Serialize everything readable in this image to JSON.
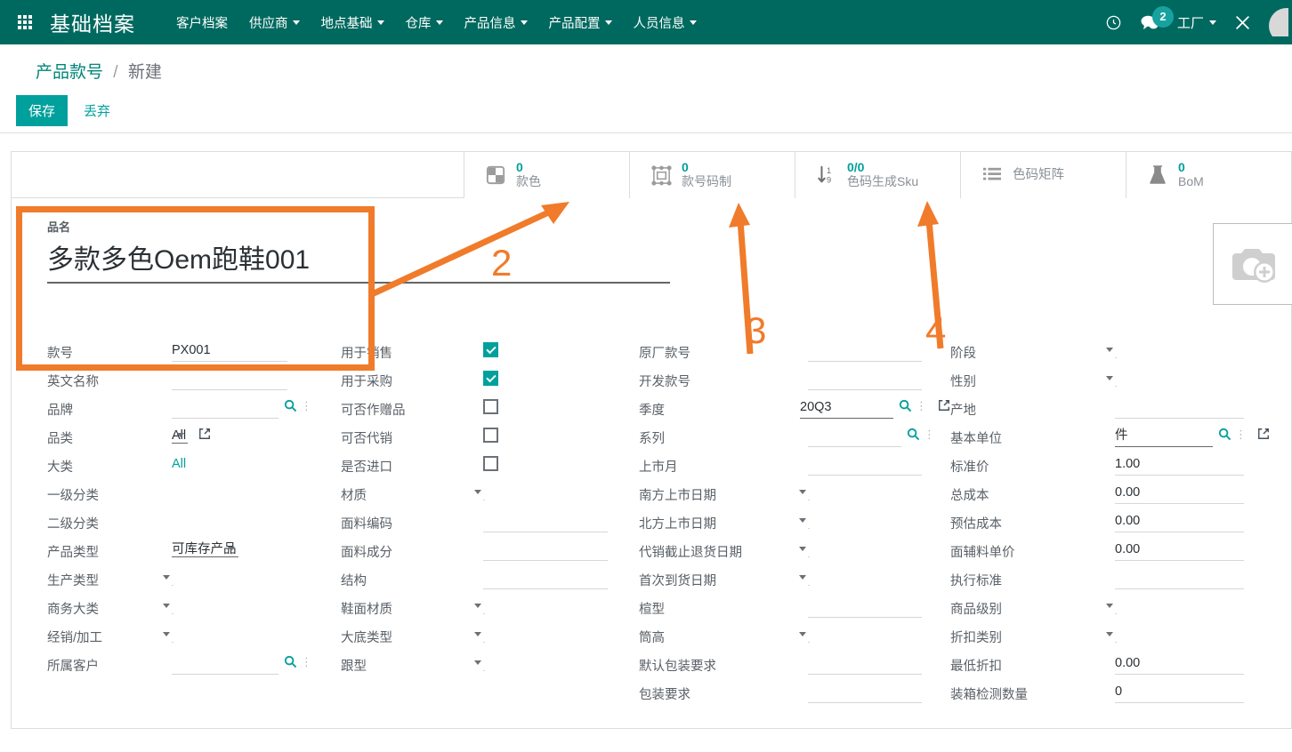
{
  "navbar": {
    "apps_icon": "grid-apps-icon",
    "brand": "基础档案",
    "menu": [
      {
        "label": "客户档案",
        "caret": false
      },
      {
        "label": "供应商",
        "caret": true
      },
      {
        "label": "地点基础",
        "caret": true
      },
      {
        "label": "仓库",
        "caret": true
      },
      {
        "label": "产品信息",
        "caret": true
      },
      {
        "label": "产品配置",
        "caret": true
      },
      {
        "label": "人员信息",
        "caret": true
      }
    ],
    "right": {
      "clock_icon": "clock-icon",
      "chat_icon": "chat-bubble-icon",
      "chat_badge": "2",
      "company": "工厂",
      "tools_icon": "wrench-icon",
      "avatar": "user-avatar"
    }
  },
  "breadcrumb": {
    "root": "产品款号",
    "separator": "/",
    "current": "新建"
  },
  "actions": {
    "save": "保存",
    "discard": "丢弃"
  },
  "stat_buttons": [
    {
      "value": "0",
      "label": "款色",
      "icon": "checkerboard-icon"
    },
    {
      "value": "0",
      "label": "款号码制",
      "icon": "frame-select-icon"
    },
    {
      "value": "0/0",
      "label": "色码生成Sku",
      "icon": "sort-numeric-icon"
    },
    {
      "value": "",
      "label": "色码矩阵",
      "icon": "list-icon"
    },
    {
      "value": "0",
      "label": "BoM",
      "icon": "flask-icon"
    }
  ],
  "title": {
    "label": "品名",
    "value": "多款多色Oem跑鞋001"
  },
  "photo": {
    "icon": "camera-add-icon"
  },
  "columns": {
    "col1": [
      {
        "label": "款号",
        "value": "PX001",
        "type": "text"
      },
      {
        "label": "英文名称",
        "value": "",
        "type": "text"
      },
      {
        "label": "品牌",
        "value": "",
        "type": "search"
      },
      {
        "label": "品类",
        "value": "All",
        "type": "select-ext"
      },
      {
        "label": "大类",
        "value": "All",
        "type": "readonly-teal"
      },
      {
        "label": "一级分类",
        "value": "",
        "type": "blank"
      },
      {
        "label": "二级分类",
        "value": "",
        "type": "blank"
      },
      {
        "label": "产品类型",
        "value": "可库存产品",
        "type": "select"
      },
      {
        "label": "生产类型",
        "value": "",
        "type": "select"
      },
      {
        "label": "商务大类",
        "value": "",
        "type": "select"
      },
      {
        "label": "经销/加工",
        "value": "",
        "type": "select"
      },
      {
        "label": "所属客户",
        "value": "",
        "type": "search"
      }
    ],
    "col2": [
      {
        "label": "用于销售",
        "value": "",
        "type": "checkbox",
        "checked": true
      },
      {
        "label": "用于采购",
        "value": "",
        "type": "checkbox",
        "checked": true
      },
      {
        "label": "可否作赠品",
        "value": "",
        "type": "checkbox",
        "checked": false
      },
      {
        "label": "可否代销",
        "value": "",
        "type": "checkbox",
        "checked": false
      },
      {
        "label": "是否进口",
        "value": "",
        "type": "checkbox",
        "checked": false
      },
      {
        "label": "材质",
        "value": "",
        "type": "select"
      },
      {
        "label": "面料编码",
        "value": "",
        "type": "text"
      },
      {
        "label": "面料成分",
        "value": "",
        "type": "text"
      },
      {
        "label": "结构",
        "value": "",
        "type": "text"
      },
      {
        "label": "鞋面材质",
        "value": "",
        "type": "select"
      },
      {
        "label": "大底类型",
        "value": "",
        "type": "select"
      },
      {
        "label": "跟型",
        "value": "",
        "type": "select"
      }
    ],
    "col3": [
      {
        "label": "原厂款号",
        "value": "",
        "type": "text"
      },
      {
        "label": "开发款号",
        "value": "",
        "type": "text"
      },
      {
        "label": "季度",
        "value": "20Q3",
        "type": "search-ext"
      },
      {
        "label": "系列",
        "value": "",
        "type": "search"
      },
      {
        "label": "上市月",
        "value": "",
        "type": "text"
      },
      {
        "label": "南方上市日期",
        "value": "",
        "type": "select"
      },
      {
        "label": "北方上市日期",
        "value": "",
        "type": "select"
      },
      {
        "label": "代销截止退货日期",
        "value": "",
        "type": "select"
      },
      {
        "label": "首次到货日期",
        "value": "",
        "type": "select"
      },
      {
        "label": "楦型",
        "value": "",
        "type": "text"
      },
      {
        "label": "筒高",
        "value": "",
        "type": "select"
      },
      {
        "label": "默认包装要求",
        "value": "",
        "type": "text"
      },
      {
        "label": "包装要求",
        "value": "",
        "type": "text"
      }
    ],
    "col4": [
      {
        "label": "阶段",
        "value": "",
        "type": "select"
      },
      {
        "label": "性别",
        "value": "",
        "type": "select"
      },
      {
        "label": "产地",
        "value": "",
        "type": "text"
      },
      {
        "label": "基本单位",
        "value": "件",
        "type": "search-ext"
      },
      {
        "label": "标准价",
        "value": "1.00",
        "type": "text"
      },
      {
        "label": "总成本",
        "value": "0.00",
        "type": "text"
      },
      {
        "label": "预估成本",
        "value": "0.00",
        "type": "text"
      },
      {
        "label": "面辅料单价",
        "value": "0.00",
        "type": "text"
      },
      {
        "label": "执行标准",
        "value": "",
        "type": "text"
      },
      {
        "label": "商品级别",
        "value": "",
        "type": "select"
      },
      {
        "label": "折扣类别",
        "value": "",
        "type": "select"
      },
      {
        "label": "最低折扣",
        "value": "0.00",
        "type": "text"
      },
      {
        "label": "装箱检测数量",
        "value": "0",
        "type": "text"
      }
    ]
  },
  "annotations": {
    "highlight_color": "#F07B2A",
    "markers": [
      {
        "number": "2",
        "points_to": "款色"
      },
      {
        "number": "3",
        "points_to": "款号码制"
      },
      {
        "number": "4",
        "points_to": "色码生成Sku"
      }
    ],
    "highlight_region": "品名 / 款号 field group"
  },
  "theme": {
    "navbar_bg": "#00695f",
    "accent": "#00a09d",
    "annotation": "#F07B2A"
  }
}
